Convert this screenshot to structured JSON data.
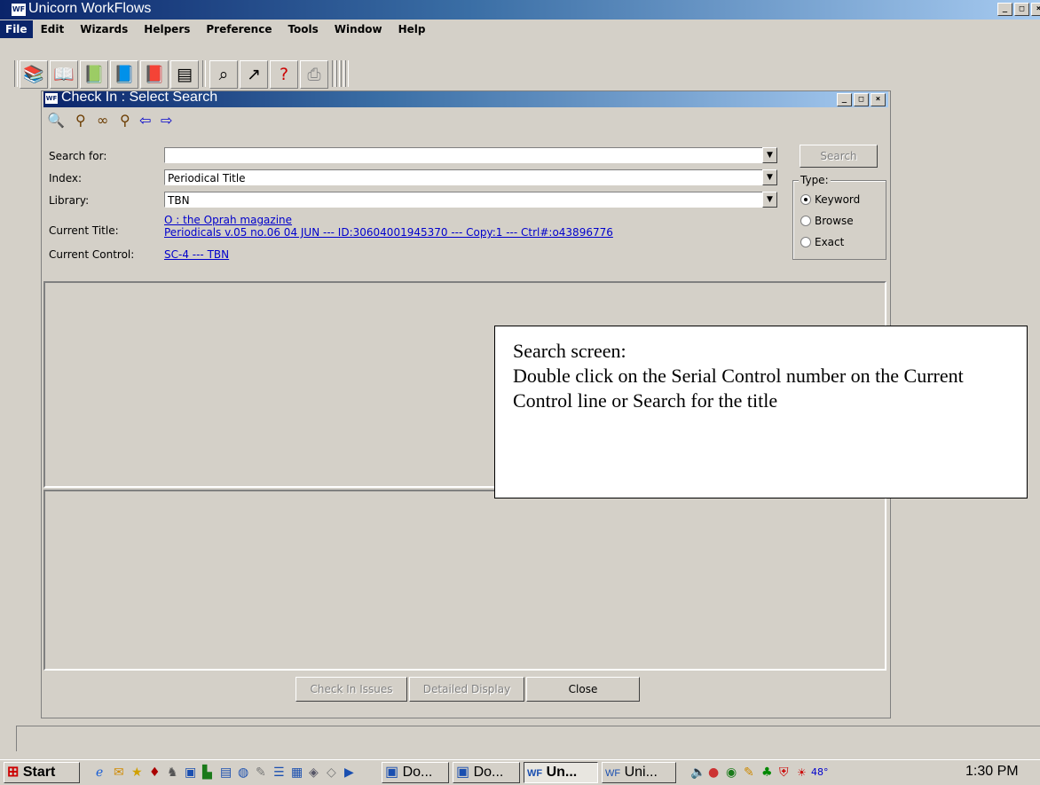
{
  "app": {
    "title": "Unicorn WorkFlows",
    "icon_text": "WF"
  },
  "window_buttons": {
    "minimize": "_",
    "maximize": "□",
    "close": "×"
  },
  "menu": [
    "File",
    "Edit",
    "Wizards",
    "Helpers",
    "Preference",
    "Tools",
    "Window",
    "Help"
  ],
  "toolbar_icons": [
    "checkout-icon",
    "checkin-icon",
    "renew-icon",
    "edit-user-icon",
    "discharge-icon",
    "display-icon",
    "search-icon",
    "reports-icon",
    "help-icon",
    "print-icon"
  ],
  "child": {
    "title": "Check In : Select Search",
    "toolbar_icons": [
      "binoculars-icon",
      "binoculars-alt-icon",
      "glasses-icon",
      "find-item-icon",
      "left-arrow-icon",
      "right-arrow-icon"
    ],
    "search_for": {
      "label": "Search for:",
      "value": ""
    },
    "index": {
      "label": "Index:",
      "value": "Periodical Title"
    },
    "library": {
      "label": "Library:",
      "value": "TBN"
    },
    "current_title": {
      "label": "Current Title:",
      "line1": "O : the Oprah magazine",
      "line2": "Periodicals v.05 no.06 04 JUN --- ID:30604001945370 --- Copy:1 --- Ctrl#:o43896776"
    },
    "current_control": {
      "label": "Current Control:",
      "value": "SC-4 --- TBN"
    },
    "search_button": "Search",
    "type": {
      "label": "Type:",
      "options": [
        "Keyword",
        "Browse",
        "Exact"
      ],
      "selected": "Keyword"
    },
    "buttons": {
      "check_in_issues": "Check In Issues",
      "detailed_display": "Detailed Display",
      "close": "Close"
    }
  },
  "callout": {
    "line1": "Search screen:",
    "line2": "Double click on the Serial Control number on the Current Control line or Search for the title"
  },
  "taskbar": {
    "start": "Start",
    "tasks": [
      "Do...",
      "Do...",
      "Un...",
      "Uni..."
    ],
    "clock": "1:30 PM",
    "tray_temp": "48°"
  }
}
